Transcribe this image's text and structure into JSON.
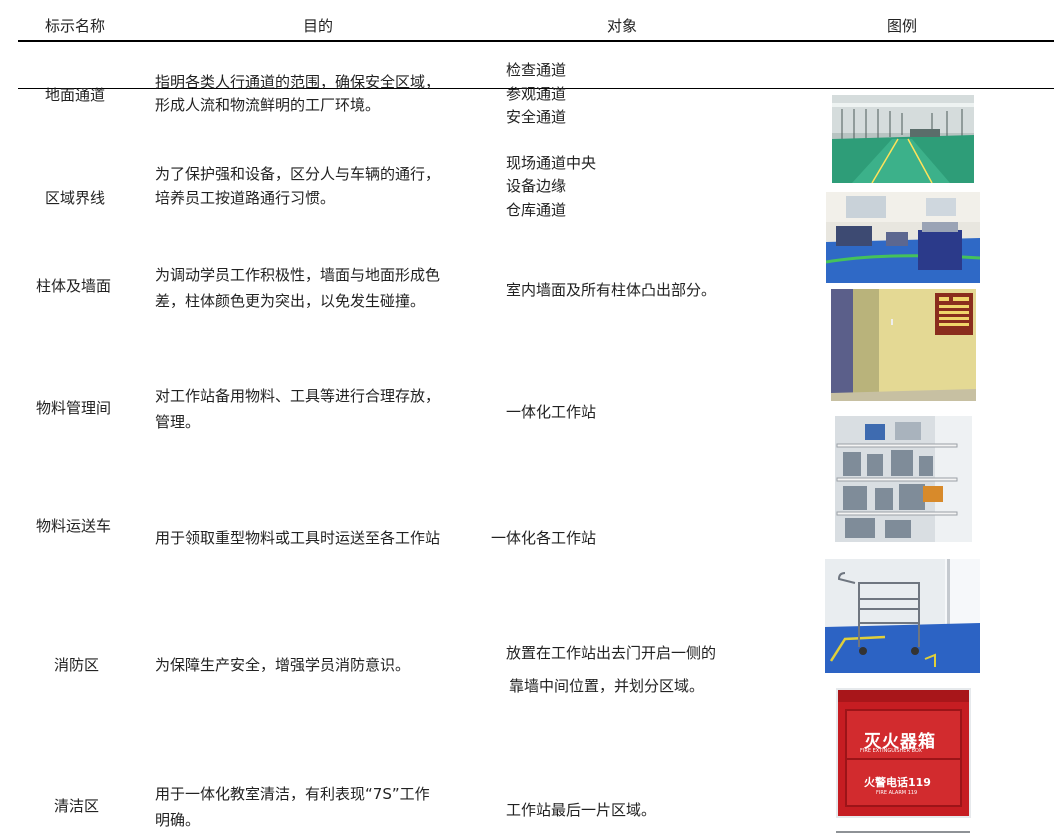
{
  "header": {
    "col_name": "标示名称",
    "col_purpose": "目的",
    "col_target": "对象",
    "col_image": "图例"
  },
  "rows": [
    {
      "name": "地面通道",
      "purpose": [
        "指明各类人行通道的范围，确保安全区域，",
        "形成人流和物流鲜明的工厂环境。"
      ],
      "target": [
        "检查通道",
        "参观通道",
        "安全通道"
      ]
    },
    {
      "name": "区域界线",
      "purpose": [
        "为了保护强和设备，区分人与车辆的通行，",
        "培养员工按道路通行习惯。"
      ],
      "target": [
        "现场通道中央",
        "设备边缘",
        "仓库通道"
      ]
    },
    {
      "name": "柱体及墙面",
      "purpose": [
        "为调动学员工作积极性，墙面与地面形成色",
        "差，柱体颜色更为突出，以免发生碰撞。"
      ],
      "target": [
        "室内墙面及所有柱体凸出部分。"
      ]
    },
    {
      "name": "物料管理间",
      "purpose": [
        "对工作站备用物料、工具等进行合理存放，",
        "管理。"
      ],
      "target": [
        "一体化工作站"
      ]
    },
    {
      "name": "物料运送车",
      "purpose": [
        "用于领取重型物料或工具时运送至各工作站"
      ],
      "target": [
        "一体化各工作站"
      ]
    },
    {
      "name": "消防区",
      "purpose": [
        "为保障生产安全，增强学员消防意识。"
      ],
      "target": [
        "放置在工作站出去门开启一侧的",
        "靠墙中间位置，并划分区域。"
      ]
    },
    {
      "name": "清洁区",
      "purpose": [
        "用于一体化教室清洁，有利表现“7S”工作",
        "明确。"
      ],
      "target": [
        "工作站最后一片区域。"
      ]
    }
  ],
  "fire_box": {
    "title": "灭火器箱",
    "subtitle": "FIRE EXTINGUISHER BOX",
    "alarm": "火警电话119",
    "alarm_en": "FIRE ALARM 119"
  }
}
